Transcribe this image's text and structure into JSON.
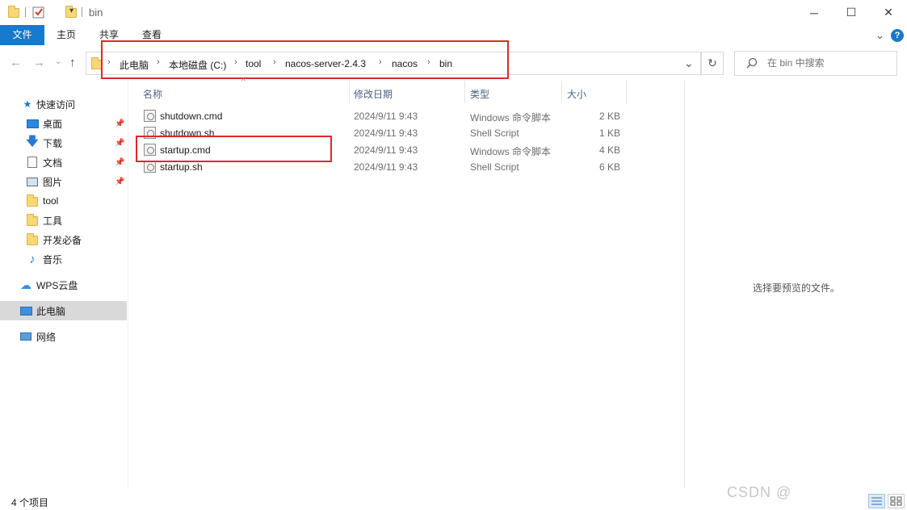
{
  "window": {
    "title": "bin",
    "minimize_label": "─",
    "maximize_label": "☐",
    "close_label": "✕"
  },
  "ribbon": {
    "tabs": [
      {
        "label": "文件"
      },
      {
        "label": "主页"
      },
      {
        "label": "共享"
      },
      {
        "label": "查看"
      }
    ],
    "expand_label": "⌄",
    "help_label": "?"
  },
  "address": {
    "crumbs": [
      "此电脑",
      "本地磁盘 (C:)",
      "tool",
      "nacos-server-2.4.3",
      "nacos",
      "bin"
    ],
    "separator": "›",
    "dropdown_label": "⌄",
    "refresh_label": "↻"
  },
  "search": {
    "placeholder": "在 bin 中搜索",
    "icon": "search-icon"
  },
  "nav": {
    "items": [
      {
        "label": "快速访问",
        "icon": "star-icon"
      },
      {
        "label": "桌面",
        "icon": "desktop-icon",
        "pinned": true
      },
      {
        "label": "下载",
        "icon": "download-icon",
        "pinned": true
      },
      {
        "label": "文档",
        "icon": "document-icon",
        "pinned": true
      },
      {
        "label": "图片",
        "icon": "picture-icon",
        "pinned": true
      },
      {
        "label": "tool",
        "icon": "folder-icon"
      },
      {
        "label": "工具",
        "icon": "folder-icon"
      },
      {
        "label": "开发必备",
        "icon": "folder-icon"
      },
      {
        "label": "音乐",
        "icon": "music-icon"
      },
      {
        "label": "WPS云盘",
        "icon": "cloud-icon"
      },
      {
        "label": "此电脑",
        "icon": "computer-icon",
        "selected": true
      },
      {
        "label": "网络",
        "icon": "network-icon"
      }
    ]
  },
  "files": {
    "columns": [
      "名称",
      "修改日期",
      "类型",
      "大小"
    ],
    "rows": [
      {
        "name": "shutdown.cmd",
        "date": "2024/9/11 9:43",
        "type": "Windows 命令脚本",
        "size": "2 KB"
      },
      {
        "name": "shutdown.sh",
        "date": "2024/9/11 9:43",
        "type": "Shell Script",
        "size": "1 KB"
      },
      {
        "name": "startup.cmd",
        "date": "2024/9/11 9:43",
        "type": "Windows 命令脚本",
        "size": "4 KB"
      },
      {
        "name": "startup.sh",
        "date": "2024/9/11 9:43",
        "type": "Shell Script",
        "size": "6 KB"
      }
    ]
  },
  "preview": {
    "message": "选择要预览的文件。"
  },
  "status": {
    "item_count": "4 个项目"
  },
  "watermark": "CSDN @",
  "colors": {
    "accent": "#1979ca",
    "annotation": "#e0272d",
    "selected": "#cde8ff",
    "header_text": "#4d6082"
  }
}
